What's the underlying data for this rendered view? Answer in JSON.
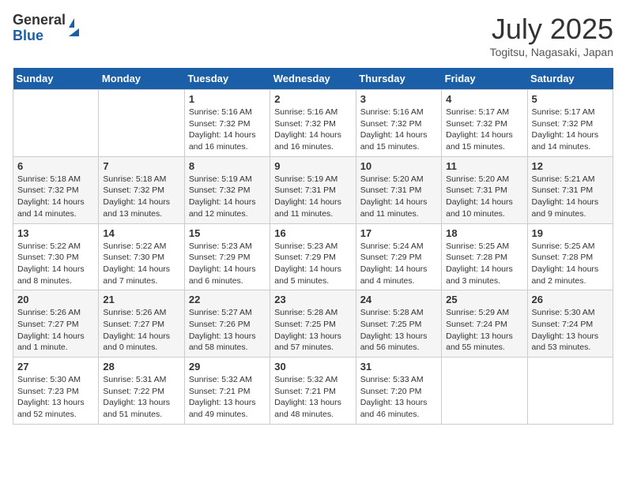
{
  "logo": {
    "text1": "General",
    "text2": "Blue"
  },
  "title": "July 2025",
  "location": "Togitsu, Nagasaki, Japan",
  "days_of_week": [
    "Sunday",
    "Monday",
    "Tuesday",
    "Wednesday",
    "Thursday",
    "Friday",
    "Saturday"
  ],
  "weeks": [
    [
      null,
      null,
      {
        "day": 1,
        "sunrise": "5:16 AM",
        "sunset": "7:32 PM",
        "daylight": "14 hours and 16 minutes."
      },
      {
        "day": 2,
        "sunrise": "5:16 AM",
        "sunset": "7:32 PM",
        "daylight": "14 hours and 16 minutes."
      },
      {
        "day": 3,
        "sunrise": "5:16 AM",
        "sunset": "7:32 PM",
        "daylight": "14 hours and 15 minutes."
      },
      {
        "day": 4,
        "sunrise": "5:17 AM",
        "sunset": "7:32 PM",
        "daylight": "14 hours and 15 minutes."
      },
      {
        "day": 5,
        "sunrise": "5:17 AM",
        "sunset": "7:32 PM",
        "daylight": "14 hours and 14 minutes."
      }
    ],
    [
      {
        "day": 6,
        "sunrise": "5:18 AM",
        "sunset": "7:32 PM",
        "daylight": "14 hours and 14 minutes."
      },
      {
        "day": 7,
        "sunrise": "5:18 AM",
        "sunset": "7:32 PM",
        "daylight": "14 hours and 13 minutes."
      },
      {
        "day": 8,
        "sunrise": "5:19 AM",
        "sunset": "7:32 PM",
        "daylight": "14 hours and 12 minutes."
      },
      {
        "day": 9,
        "sunrise": "5:19 AM",
        "sunset": "7:31 PM",
        "daylight": "14 hours and 11 minutes."
      },
      {
        "day": 10,
        "sunrise": "5:20 AM",
        "sunset": "7:31 PM",
        "daylight": "14 hours and 11 minutes."
      },
      {
        "day": 11,
        "sunrise": "5:20 AM",
        "sunset": "7:31 PM",
        "daylight": "14 hours and 10 minutes."
      },
      {
        "day": 12,
        "sunrise": "5:21 AM",
        "sunset": "7:31 PM",
        "daylight": "14 hours and 9 minutes."
      }
    ],
    [
      {
        "day": 13,
        "sunrise": "5:22 AM",
        "sunset": "7:30 PM",
        "daylight": "14 hours and 8 minutes."
      },
      {
        "day": 14,
        "sunrise": "5:22 AM",
        "sunset": "7:30 PM",
        "daylight": "14 hours and 7 minutes."
      },
      {
        "day": 15,
        "sunrise": "5:23 AM",
        "sunset": "7:29 PM",
        "daylight": "14 hours and 6 minutes."
      },
      {
        "day": 16,
        "sunrise": "5:23 AM",
        "sunset": "7:29 PM",
        "daylight": "14 hours and 5 minutes."
      },
      {
        "day": 17,
        "sunrise": "5:24 AM",
        "sunset": "7:29 PM",
        "daylight": "14 hours and 4 minutes."
      },
      {
        "day": 18,
        "sunrise": "5:25 AM",
        "sunset": "7:28 PM",
        "daylight": "14 hours and 3 minutes."
      },
      {
        "day": 19,
        "sunrise": "5:25 AM",
        "sunset": "7:28 PM",
        "daylight": "14 hours and 2 minutes."
      }
    ],
    [
      {
        "day": 20,
        "sunrise": "5:26 AM",
        "sunset": "7:27 PM",
        "daylight": "14 hours and 1 minute."
      },
      {
        "day": 21,
        "sunrise": "5:26 AM",
        "sunset": "7:27 PM",
        "daylight": "14 hours and 0 minutes."
      },
      {
        "day": 22,
        "sunrise": "5:27 AM",
        "sunset": "7:26 PM",
        "daylight": "13 hours and 58 minutes."
      },
      {
        "day": 23,
        "sunrise": "5:28 AM",
        "sunset": "7:25 PM",
        "daylight": "13 hours and 57 minutes."
      },
      {
        "day": 24,
        "sunrise": "5:28 AM",
        "sunset": "7:25 PM",
        "daylight": "13 hours and 56 minutes."
      },
      {
        "day": 25,
        "sunrise": "5:29 AM",
        "sunset": "7:24 PM",
        "daylight": "13 hours and 55 minutes."
      },
      {
        "day": 26,
        "sunrise": "5:30 AM",
        "sunset": "7:24 PM",
        "daylight": "13 hours and 53 minutes."
      }
    ],
    [
      {
        "day": 27,
        "sunrise": "5:30 AM",
        "sunset": "7:23 PM",
        "daylight": "13 hours and 52 minutes."
      },
      {
        "day": 28,
        "sunrise": "5:31 AM",
        "sunset": "7:22 PM",
        "daylight": "13 hours and 51 minutes."
      },
      {
        "day": 29,
        "sunrise": "5:32 AM",
        "sunset": "7:21 PM",
        "daylight": "13 hours and 49 minutes."
      },
      {
        "day": 30,
        "sunrise": "5:32 AM",
        "sunset": "7:21 PM",
        "daylight": "13 hours and 48 minutes."
      },
      {
        "day": 31,
        "sunrise": "5:33 AM",
        "sunset": "7:20 PM",
        "daylight": "13 hours and 46 minutes."
      },
      null,
      null
    ]
  ]
}
